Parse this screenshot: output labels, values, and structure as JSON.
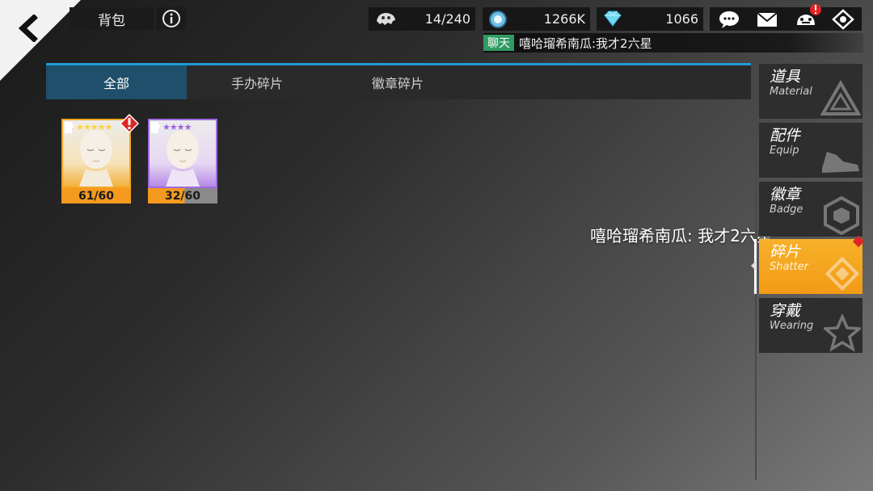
{
  "header": {
    "title": "背包",
    "resources": {
      "capacity": "14/240",
      "coins": "1266K",
      "gems": "1066"
    }
  },
  "chat": {
    "tag": "聊天",
    "message": "嘻哈瑠希南瓜:我才2六星"
  },
  "tabs": [
    {
      "label": "全部",
      "active": true
    },
    {
      "label": "手办碎片",
      "active": false
    },
    {
      "label": "徽章碎片",
      "active": false
    }
  ],
  "items": [
    {
      "count": "61/60",
      "rarity": "gold",
      "stars": "★★★★★",
      "alert": true
    },
    {
      "count": "32/60",
      "rarity": "purple",
      "stars": "★★★★",
      "alert": false
    }
  ],
  "floating_message": "嘻哈瑠希南瓜: 我才2六星",
  "categories": [
    {
      "cn": "道具",
      "en": "Material",
      "active": false
    },
    {
      "cn": "配件",
      "en": "Equip",
      "active": false
    },
    {
      "cn": "徽章",
      "en": "Badge",
      "active": false
    },
    {
      "cn": "碎片",
      "en": "Shatter",
      "active": true
    },
    {
      "cn": "穿戴",
      "en": "Wearing",
      "active": false
    }
  ],
  "colors": {
    "accent_blue": "#1e9ad6",
    "active_tab": "#1f4f6a",
    "active_category": "#f29a16",
    "chat_tag": "#2f9a63",
    "gold_frame": "#f3a623",
    "purple_frame": "#a06be0"
  },
  "icons": [
    "back-arrow-icon",
    "info-icon",
    "skull-icon",
    "coin-icon",
    "diamond-icon",
    "chat-bubble-icon",
    "mail-icon",
    "friends-icon",
    "settings-icon",
    "puzzle-icon",
    "alert-icon"
  ]
}
